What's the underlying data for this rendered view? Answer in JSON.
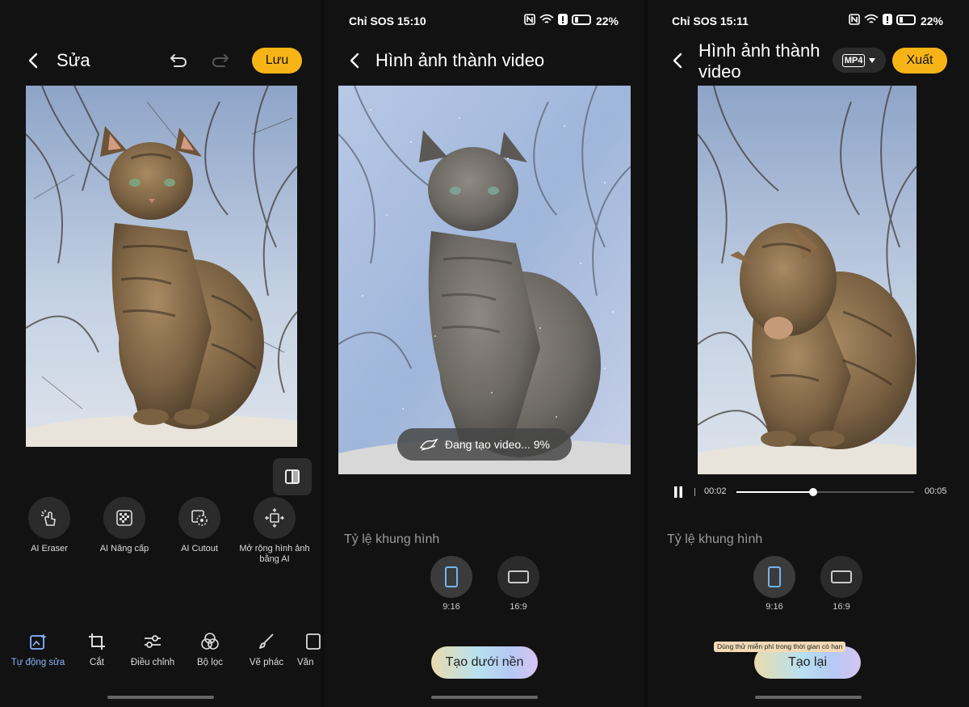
{
  "panel1": {
    "title": "Sửa",
    "save_label": "Lưu",
    "ai_tools": [
      {
        "label": "AI Eraser",
        "icon": "eraser-hand-icon"
      },
      {
        "label": "AI Nâng cấp",
        "icon": "enhance-grid-icon"
      },
      {
        "label": "AI Cutout",
        "icon": "cutout-icon"
      },
      {
        "label": "Mở rộng hình ảnh bằng AI",
        "icon": "expand-image-icon"
      }
    ],
    "bottom_tabs": [
      {
        "label": "Tự động sửa",
        "icon": "auto-edit-icon",
        "active": true
      },
      {
        "label": "Cắt",
        "icon": "crop-icon",
        "active": false
      },
      {
        "label": "Điều chỉnh",
        "icon": "sliders-icon",
        "active": false
      },
      {
        "label": "Bộ lọc",
        "icon": "filter-circles-icon",
        "active": false
      },
      {
        "label": "Vẽ phác",
        "icon": "brush-icon",
        "active": false
      },
      {
        "label": "Văn",
        "icon": "text-icon",
        "active": false
      }
    ]
  },
  "panel2": {
    "status": {
      "carrier": "Chỉ SOS 15:10",
      "battery": "22%"
    },
    "title": "Hình ảnh thành video",
    "progress_text": "Đang tạo video... 9%",
    "ratio_label": "Tỷ lệ khung hình",
    "ratios": [
      {
        "label": "9:16",
        "selected": true
      },
      {
        "label": "16:9",
        "selected": false
      }
    ],
    "action_label": "Tạo dưới nền"
  },
  "panel3": {
    "status": {
      "carrier": "Chỉ SOS 15:11",
      "battery": "22%"
    },
    "title_line1": "Hình ảnh thành",
    "title_line2": "video",
    "format": "MP4",
    "export_label": "Xuất",
    "player": {
      "current": "00:02",
      "duration": "00:05",
      "progress": 0.43
    },
    "ratio_label": "Tỷ lệ khung hình",
    "ratios": [
      {
        "label": "9:16",
        "selected": true
      },
      {
        "label": "16:9",
        "selected": false
      }
    ],
    "promo_badge": "Dùng thử miễn phí trong thời gian có hạn",
    "action_label": "Tạo lại"
  },
  "colors": {
    "accent": "#f6b417",
    "active_tab": "#8ab4ff",
    "background": "#121212"
  }
}
